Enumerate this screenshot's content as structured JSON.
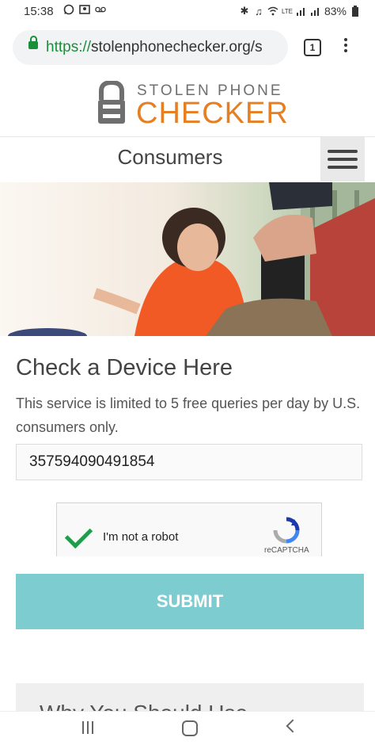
{
  "status_bar": {
    "time": "15:38",
    "battery": "83%",
    "icons": [
      "whatsapp-icon",
      "gallery-icon",
      "voicemail-icon",
      "bluetooth-icon",
      "mute-icon",
      "wifi-icon",
      "volte-icon",
      "signal-icon",
      "battery-icon"
    ]
  },
  "browser": {
    "url_scheme": "https://",
    "url_host": "stolenphonechecker.org/s",
    "tab_count": "1"
  },
  "logo": {
    "line1": "STOLEN PHONE",
    "line2": "CHECKER"
  },
  "header": {
    "title": "Consumers"
  },
  "form": {
    "heading": "Check a Device Here",
    "description": "This service is limited to 5 free queries per day by U.S. consumers only.",
    "imei_value": "357594090491854",
    "captcha_label": "I'm not a robot",
    "captcha_brand": "reCAPTCHA",
    "submit_label": "SUBMIT"
  },
  "next_section": {
    "heading_partial": "Why You Should Use"
  },
  "colors": {
    "accent_orange": "#e67e22",
    "submit_teal": "#7dcdd0",
    "secure_green": "#1a8f3a"
  }
}
